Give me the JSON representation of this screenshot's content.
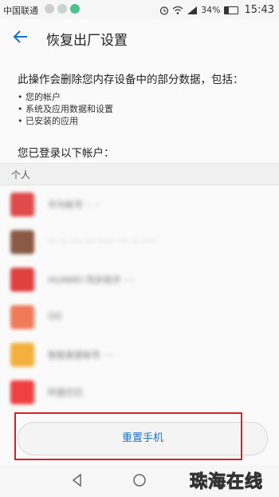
{
  "status_bar": {
    "carrier": "中国联通",
    "battery": "34%",
    "time": "15:43",
    "icons": [
      "signal-icon",
      "wifi-icon",
      "alarm-icon"
    ]
  },
  "header": {
    "title": "恢复出厂设置",
    "back_icon": "arrow-left-icon"
  },
  "warning_text": "此操作会删除您内存设备中的部分数据，包括：",
  "bullets": [
    "您的帐户",
    "系统及应用数据和设置",
    "已安装的应用"
  ],
  "logged_in_label": "您已登录以下帐户：",
  "section_label": "个人",
  "accounts": [
    {
      "text": "华为帐号 ·· ··",
      "icon_color": "#e04a4a"
    },
    {
      "text": "··· ··· ···· ···· ······ ···· ··· ·····",
      "icon_color": "#8a5a44"
    },
    {
      "text": "HUAWEI 同步助手 ····",
      "icon_color": "#e04040"
    },
    {
      "text": "QQ",
      "icon_color": "#f07a5a"
    },
    {
      "text": "智能家居帐号 ····",
      "icon_color": "#f4b03c"
    },
    {
      "text": "阿里巴巴",
      "icon_color": "#f04040"
    }
  ],
  "reset_button": "重置手机",
  "watermark": "珠海在线",
  "colors": {
    "accent": "#1a73c9",
    "highlight": "#d3202a"
  }
}
